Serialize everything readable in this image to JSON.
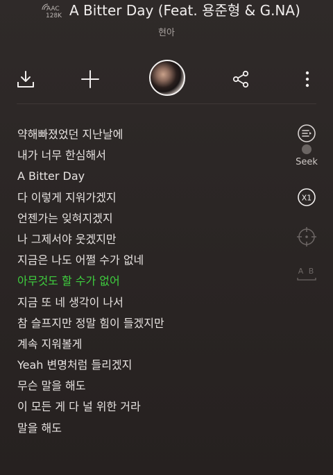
{
  "header": {
    "quality_line1": "AAC",
    "quality_line2": "128K",
    "title": "A Bitter Day (Feat. 용준형 & G.NA)",
    "artist": "현아"
  },
  "toolbar": {
    "download_icon": "download-icon",
    "add_icon": "plus-icon",
    "share_icon": "share-icon",
    "more_icon": "more-vertical-icon"
  },
  "lyrics": [
    "약해빠졌었던 지난날에",
    "내가 너무 한심해서",
    "A Bitter Day",
    "다 이렇게 지워가겠지",
    "언젠가는 잊혀지겠지",
    "나 그제서야 웃겠지만",
    "지금은 나도 어쩔 수가 없네",
    "아무것도 할 수가 없어",
    "지금 또 네 생각이 나서",
    "참 슬프지만 정말 힘이 들겠지만",
    "계속 지워볼게",
    "Yeah 변명처럼 들리겠지",
    "무슨 말을 해도",
    "이 모든 게 다 널 위한 거라",
    "말을 해도"
  ],
  "current_lyric_index": 7,
  "side": {
    "seek_label": "Seek",
    "speed_label": "X1",
    "translate_label": "A B"
  },
  "colors": {
    "highlight": "#3fcf3f",
    "background": "#2b2625"
  }
}
